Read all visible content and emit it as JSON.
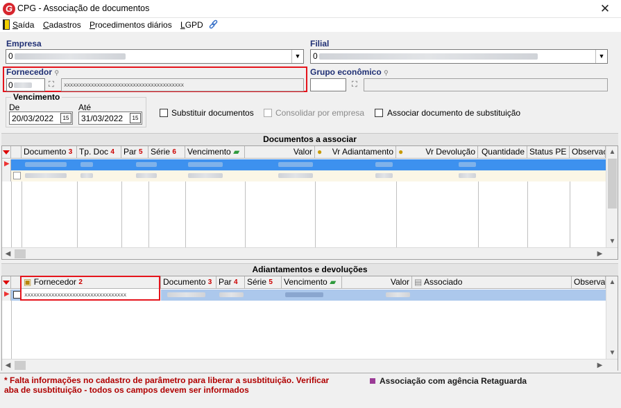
{
  "window": {
    "title": "CPG - Associação de documentos",
    "close_glyph": "✕",
    "logo_letter": "G"
  },
  "menu": {
    "items": [
      {
        "label": "Saída"
      },
      {
        "label": "Cadastros"
      },
      {
        "label": "Procedimentos diários"
      },
      {
        "label": "LGPD"
      }
    ]
  },
  "form": {
    "empresa_label": "Empresa",
    "empresa_value": "0",
    "filial_label": "Filial",
    "filial_value": "0",
    "fornecedor_label": "Fornecedor",
    "fornecedor_code": "0",
    "fornecedor_name": "xxxxxxxxxxxxxxxxxxxxxxxxxxxxxxxxxxxxxxxx",
    "grupo_label": "Grupo econômico",
    "vencimento_label": "Vencimento",
    "de_label": "De",
    "de_value": "20/03/2022",
    "ate_label": "Até",
    "ate_value": "31/03/2022",
    "cal_glyph": "15",
    "chk_substituir": "Substituir documentos",
    "chk_consolidar": "Consolidar por empresa",
    "chk_associar": "Associar documento de substituição"
  },
  "documentos": {
    "title": "Documentos a associar",
    "columns": [
      {
        "label": "Documento",
        "sort": "3"
      },
      {
        "label": "Tp. Doc",
        "sort": "4"
      },
      {
        "label": "Par",
        "sort": "5"
      },
      {
        "label": "Série",
        "sort": "6"
      },
      {
        "label": "Vencimento",
        "sort": ""
      },
      {
        "label": "Valor",
        "sort": ""
      },
      {
        "label": "Vr Adiantamento",
        "sort": ""
      },
      {
        "label": "Vr Devolução",
        "sort": ""
      },
      {
        "label": "Quantidade",
        "sort": ""
      },
      {
        "label": "Status PE",
        "sort": ""
      },
      {
        "label": "Observaç",
        "sort": ""
      }
    ]
  },
  "adiantamentos": {
    "title": "Adiantamentos e devoluções",
    "columns": [
      {
        "label": "Fornecedor",
        "sort": "2"
      },
      {
        "label": "Documento",
        "sort": "3"
      },
      {
        "label": "Par",
        "sort": "4"
      },
      {
        "label": "Série",
        "sort": "5"
      },
      {
        "label": "Vencimento",
        "sort": ""
      },
      {
        "label": "Valor",
        "sort": ""
      },
      {
        "label": "Associado",
        "sort": ""
      },
      {
        "label": "Observaç",
        "sort": ""
      }
    ],
    "row_fornecedor": "xxxxxxxxxxxxxxxxxxxxxxxxxxxxxxxxxx"
  },
  "footer": {
    "note_line1": "* Falta informações no cadastro de parâmetro para liberar a susbtituição. Verificar",
    "note_line2": "aba de susbtituição - todos os campos devem ser informados",
    "legend": "Associação com agência Retaguarda",
    "legend_color": "#9b3b96"
  },
  "colors": {
    "selected_row": "#3d91ef",
    "alt_row": "#fbf6e6",
    "highlight_box": "#e5141c",
    "label_blue": "#1f2f74"
  }
}
